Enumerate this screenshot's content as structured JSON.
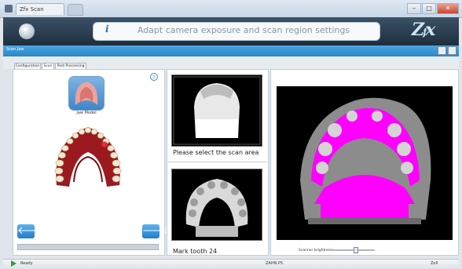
{
  "window": {
    "tab_title": "Zfx Scan",
    "controls": [
      "–",
      "□",
      "✕"
    ]
  },
  "header": {
    "info_icon": "info-icon",
    "instruction": "Adapt camera exposure and scan region settings",
    "logo": "Zfx"
  },
  "subheader": {
    "label": "Scan Jaw"
  },
  "tabs": [
    {
      "label": "Configuration"
    },
    {
      "label": "Scan"
    },
    {
      "label": "Post Processing"
    }
  ],
  "left_panel": {
    "thumbnail_label": "Jaw Model",
    "help_icon": "?",
    "prev_icon": "🡐",
    "next_icon": "🡒"
  },
  "middle_panel": {
    "top_caption": "Please select the scan area",
    "bottom_caption": "Mark tooth 24"
  },
  "right_panel": {
    "brightness_label": "Scanner brightness",
    "brightness_level": 0.55
  },
  "statusbar": {
    "left": "Ready",
    "mid": "ZAHN P5",
    "right": "Zoll"
  },
  "colors": {
    "accent": "#2b86c8",
    "mask": "#ff00ff",
    "gum": "#a91a22"
  }
}
